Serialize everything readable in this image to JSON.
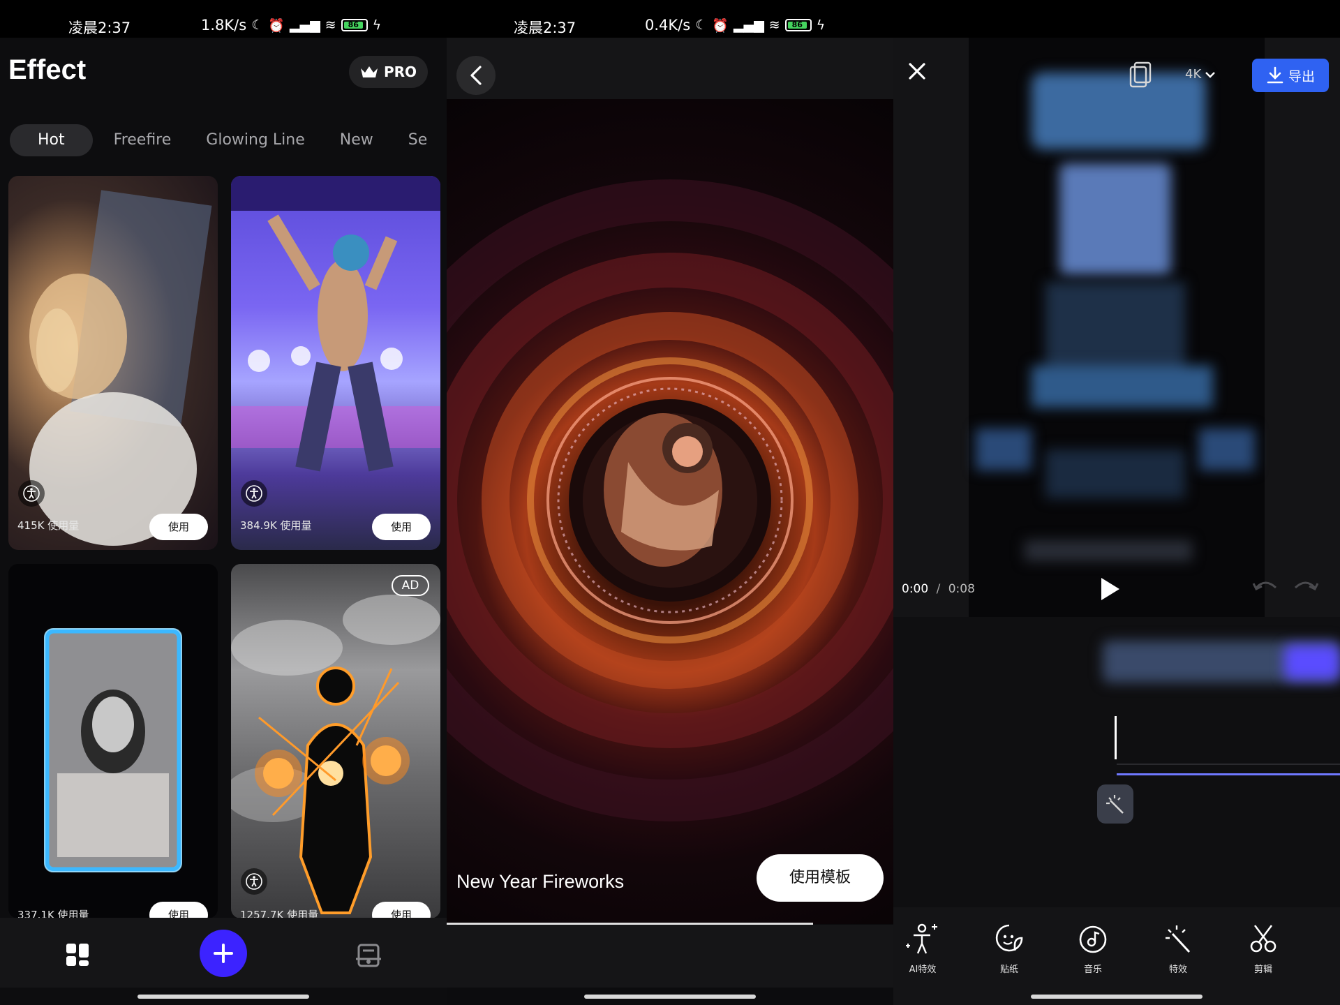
{
  "panel1": {
    "status": {
      "time": "凌晨2:37",
      "speed": "1.8K/s",
      "battery": "86"
    },
    "title": "Effect",
    "pro_label": "PRO",
    "tabs": [
      "Hot",
      "Freefire",
      "Glowing Line",
      "New",
      "Se"
    ],
    "cards": [
      {
        "usage": "415K 使用量",
        "use": "使用"
      },
      {
        "usage": "384.9K 使用量",
        "use": "使用"
      },
      {
        "usage": "337.1K 使用量",
        "use": "使用"
      },
      {
        "usage": "1257.7K 使用量",
        "use": "使用",
        "badge": "AD"
      }
    ]
  },
  "panel2": {
    "status": {
      "time": "凌晨2:37",
      "speed": "0.4K/s",
      "battery": "86"
    },
    "template_title": "New Year Fireworks",
    "use_template": "使用模板",
    "playback_progress": 0.82
  },
  "panel3": {
    "resolution": "4K",
    "export_label": "导出",
    "time_current": "0:00",
    "time_separator": "/",
    "time_total": "0:08",
    "tools": [
      {
        "label": "AI特效",
        "icon": "ai-figure-icon"
      },
      {
        "label": "贴纸",
        "icon": "sticker-icon"
      },
      {
        "label": "音乐",
        "icon": "music-icon"
      },
      {
        "label": "特效",
        "icon": "magic-wand-icon"
      },
      {
        "label": "剪辑",
        "icon": "scissors-icon"
      }
    ]
  },
  "colors": {
    "accent_blue": "#2f62f2",
    "fab_purple": "#3c23ff",
    "timeline_blue": "#6f78ff"
  }
}
